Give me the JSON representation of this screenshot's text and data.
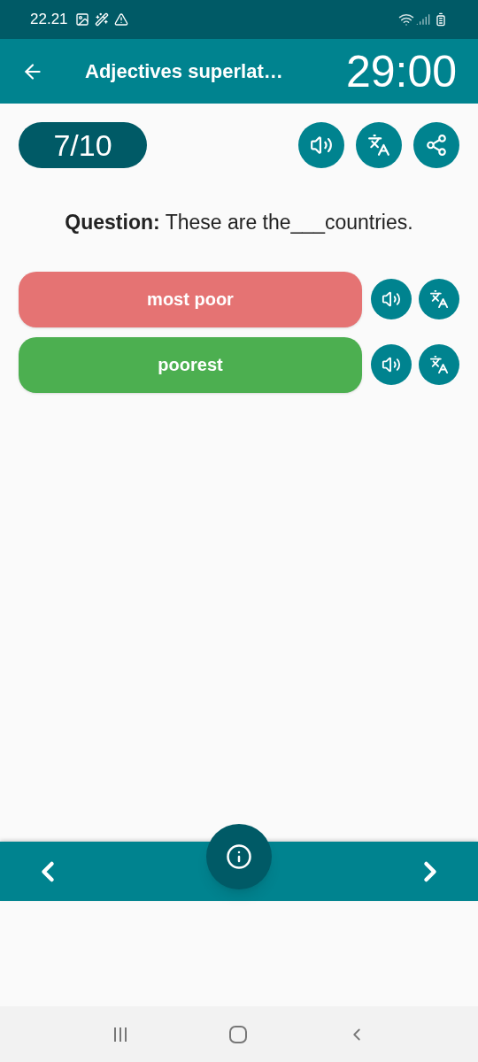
{
  "status_bar": {
    "time": "22.21"
  },
  "header": {
    "title": "Adjectives superlat…",
    "timer": "29:00"
  },
  "progress": {
    "label": "7/10"
  },
  "question": "**Question:** These are the___countries.",
  "answers": [
    {
      "text": "most poor",
      "correct": false
    },
    {
      "text": "poorest",
      "correct": true
    }
  ]
}
